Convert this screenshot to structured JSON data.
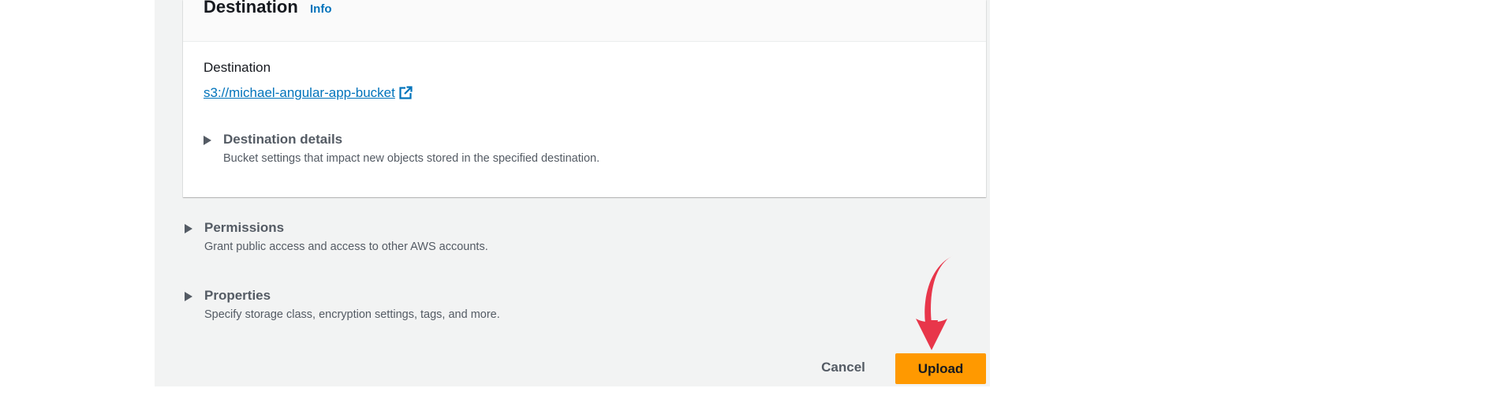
{
  "destination_section": {
    "title": "Destination",
    "info_link": "Info",
    "field_label": "Destination",
    "bucket_link": "s3://michael-angular-app-bucket",
    "details": {
      "title": "Destination details",
      "description": "Bucket settings that impact new objects stored in the specified destination."
    }
  },
  "permissions": {
    "title": "Permissions",
    "description": "Grant public access and access to other AWS accounts."
  },
  "properties": {
    "title": "Properties",
    "description": "Specify storage class, encryption settings, tags, and more."
  },
  "actions": {
    "cancel_label": "Cancel",
    "upload_label": "Upload"
  },
  "colors": {
    "link": "#0073bb",
    "primary_button": "#ff9900",
    "annotation_arrow": "#e8364a",
    "panel_background": "#f2f3f3"
  },
  "icons": {
    "external_link": "external-link-icon",
    "expand_caret": "caret-right-icon",
    "annotation": "curved-arrow-icon"
  }
}
